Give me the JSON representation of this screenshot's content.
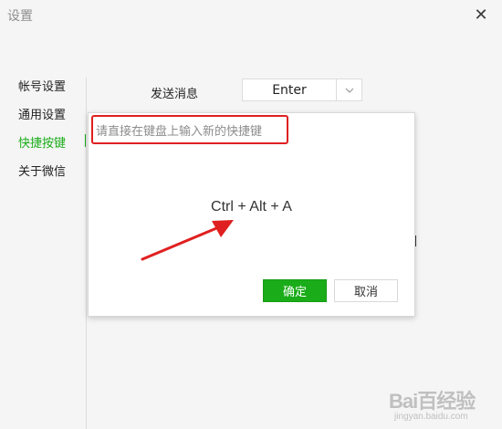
{
  "window": {
    "title": "设置",
    "close_glyph": "✕"
  },
  "sidebar": {
    "items": [
      {
        "label": "帐号设置",
        "active": false
      },
      {
        "label": "通用设置",
        "active": false
      },
      {
        "label": "快捷按键",
        "active": true
      },
      {
        "label": "关于微信",
        "active": false
      }
    ]
  },
  "shortcut_row": {
    "label": "发送消息",
    "select_value": "Enter"
  },
  "dialog": {
    "hint": "请直接在键盘上输入新的快捷键",
    "shortcut": "Ctrl + Alt + A",
    "ok_label": "确定",
    "cancel_label": "取消"
  },
  "watermark": {
    "brand": "Bai百经验",
    "url": "jingyan.baidu.com"
  },
  "colors": {
    "accent": "#1aad19",
    "annotation": "#e02020"
  },
  "icons": {
    "close": "close-icon",
    "dropdown": "chevron-down-icon"
  }
}
